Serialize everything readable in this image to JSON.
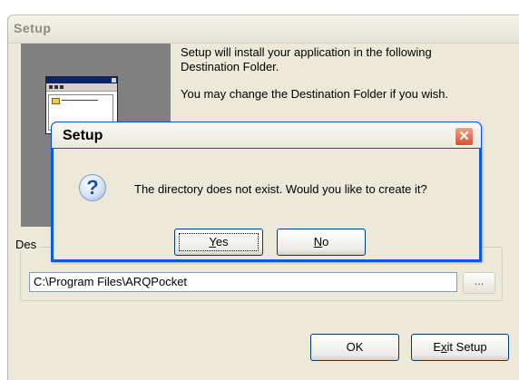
{
  "outer_window": {
    "title": "Setup",
    "intro_line1": "Setup will install your application in the following Destination Folder.",
    "intro_line2": "You may change the Destination Folder if you wish.",
    "destination_group_label": "Des",
    "destination_path": "C:\\Program Files\\ARQPocket",
    "browse_label": "...",
    "ok_label": "OK",
    "exit_label_prefix": "E",
    "exit_label_underline": "x",
    "exit_label_suffix": "it Setup"
  },
  "dialog": {
    "title": "Setup",
    "close_glyph": "✕",
    "icon_glyph": "?",
    "message": "The directory does not exist. Would you like to create it?",
    "yes_underline": "Y",
    "yes_rest": "es",
    "no_underline": "N",
    "no_rest": "o"
  }
}
